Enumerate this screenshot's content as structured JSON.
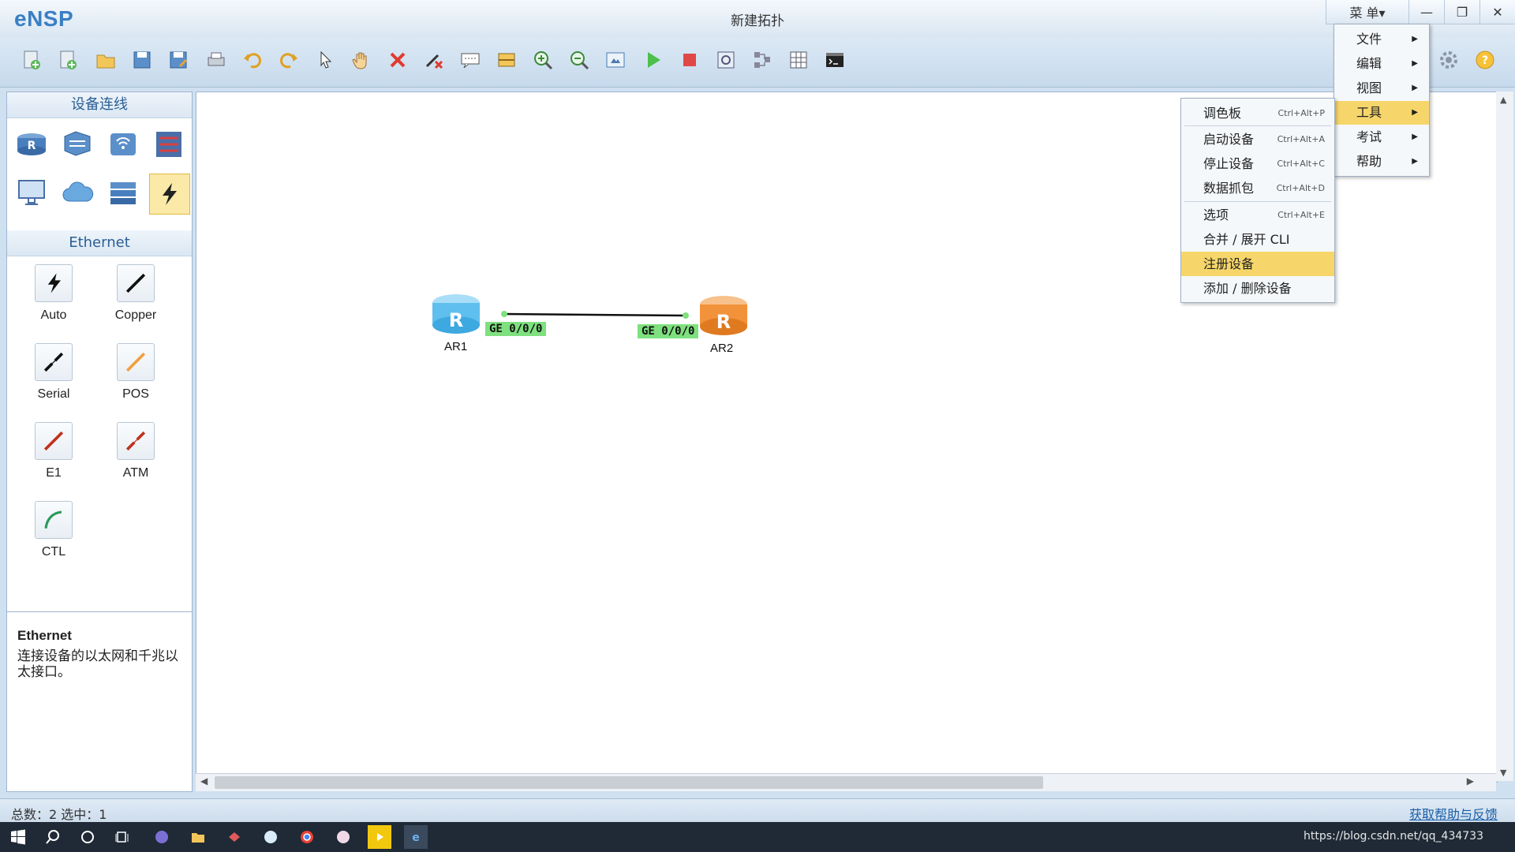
{
  "app": {
    "logo": "eNSP",
    "window_title": "新建拓扑",
    "menu_button": "菜 单▾"
  },
  "toolbar": {
    "icons": [
      "new-topology-icon",
      "new-document-icon",
      "open-icon",
      "save-icon",
      "save-as-icon",
      "print-icon",
      "undo-icon",
      "redo-icon",
      "pointer-icon",
      "pan-hand-icon",
      "delete-icon",
      "delete-link-icon",
      "text-note-icon",
      "palette-icon",
      "zoom-in-icon",
      "zoom-out-icon",
      "fit-view-icon",
      "start-icon",
      "stop-icon",
      "capture-icon",
      "topology-icon",
      "grid-icon",
      "cli-icon"
    ]
  },
  "left_panel": {
    "device_section_title": "设备连线",
    "cable_section_title": "Ethernet",
    "cables": [
      {
        "label": "Auto"
      },
      {
        "label": "Copper"
      },
      {
        "label": "Serial"
      },
      {
        "label": "POS"
      },
      {
        "label": "E1"
      },
      {
        "label": "ATM"
      },
      {
        "label": "CTL"
      }
    ],
    "description": {
      "title": "Ethernet",
      "text": "连接设备的以太网和千兆以太接口。"
    }
  },
  "topology": {
    "devices": [
      {
        "name": "AR1",
        "color": "#5fbfee"
      },
      {
        "name": "AR2",
        "color": "#f2923a"
      }
    ],
    "link": {
      "from_port": "GE 0/0/0",
      "to_port": "GE 0/0/0"
    }
  },
  "main_menu": {
    "items": [
      {
        "label": "文件"
      },
      {
        "label": "编辑"
      },
      {
        "label": "视图"
      },
      {
        "label": "工具"
      },
      {
        "label": "考试"
      },
      {
        "label": "帮助"
      }
    ],
    "highlighted": "工具"
  },
  "tools_submenu": {
    "items": [
      {
        "label": "调色板",
        "shortcut": "Ctrl+Alt+P"
      },
      {
        "label": "启动设备",
        "shortcut": "Ctrl+Alt+A"
      },
      {
        "label": "停止设备",
        "shortcut": "Ctrl+Alt+C"
      },
      {
        "label": "数据抓包",
        "shortcut": "Ctrl+Alt+D"
      },
      {
        "label": "选项",
        "shortcut": "Ctrl+Alt+E"
      },
      {
        "label": "合并 / 展开 CLI",
        "shortcut": ""
      },
      {
        "label": "注册设备",
        "shortcut": ""
      },
      {
        "label": "添加 / 删除设备",
        "shortcut": ""
      }
    ],
    "highlighted": "注册设备"
  },
  "status": {
    "left": "总数：2  选中：1",
    "right": "获取帮助与反馈"
  },
  "tray": {
    "text": "https://blog.csdn.net/qq_434733"
  },
  "colors": {
    "highlight": "#f6d66a",
    "link_label": "#7ee07e",
    "accent": "#4a8ccf"
  }
}
